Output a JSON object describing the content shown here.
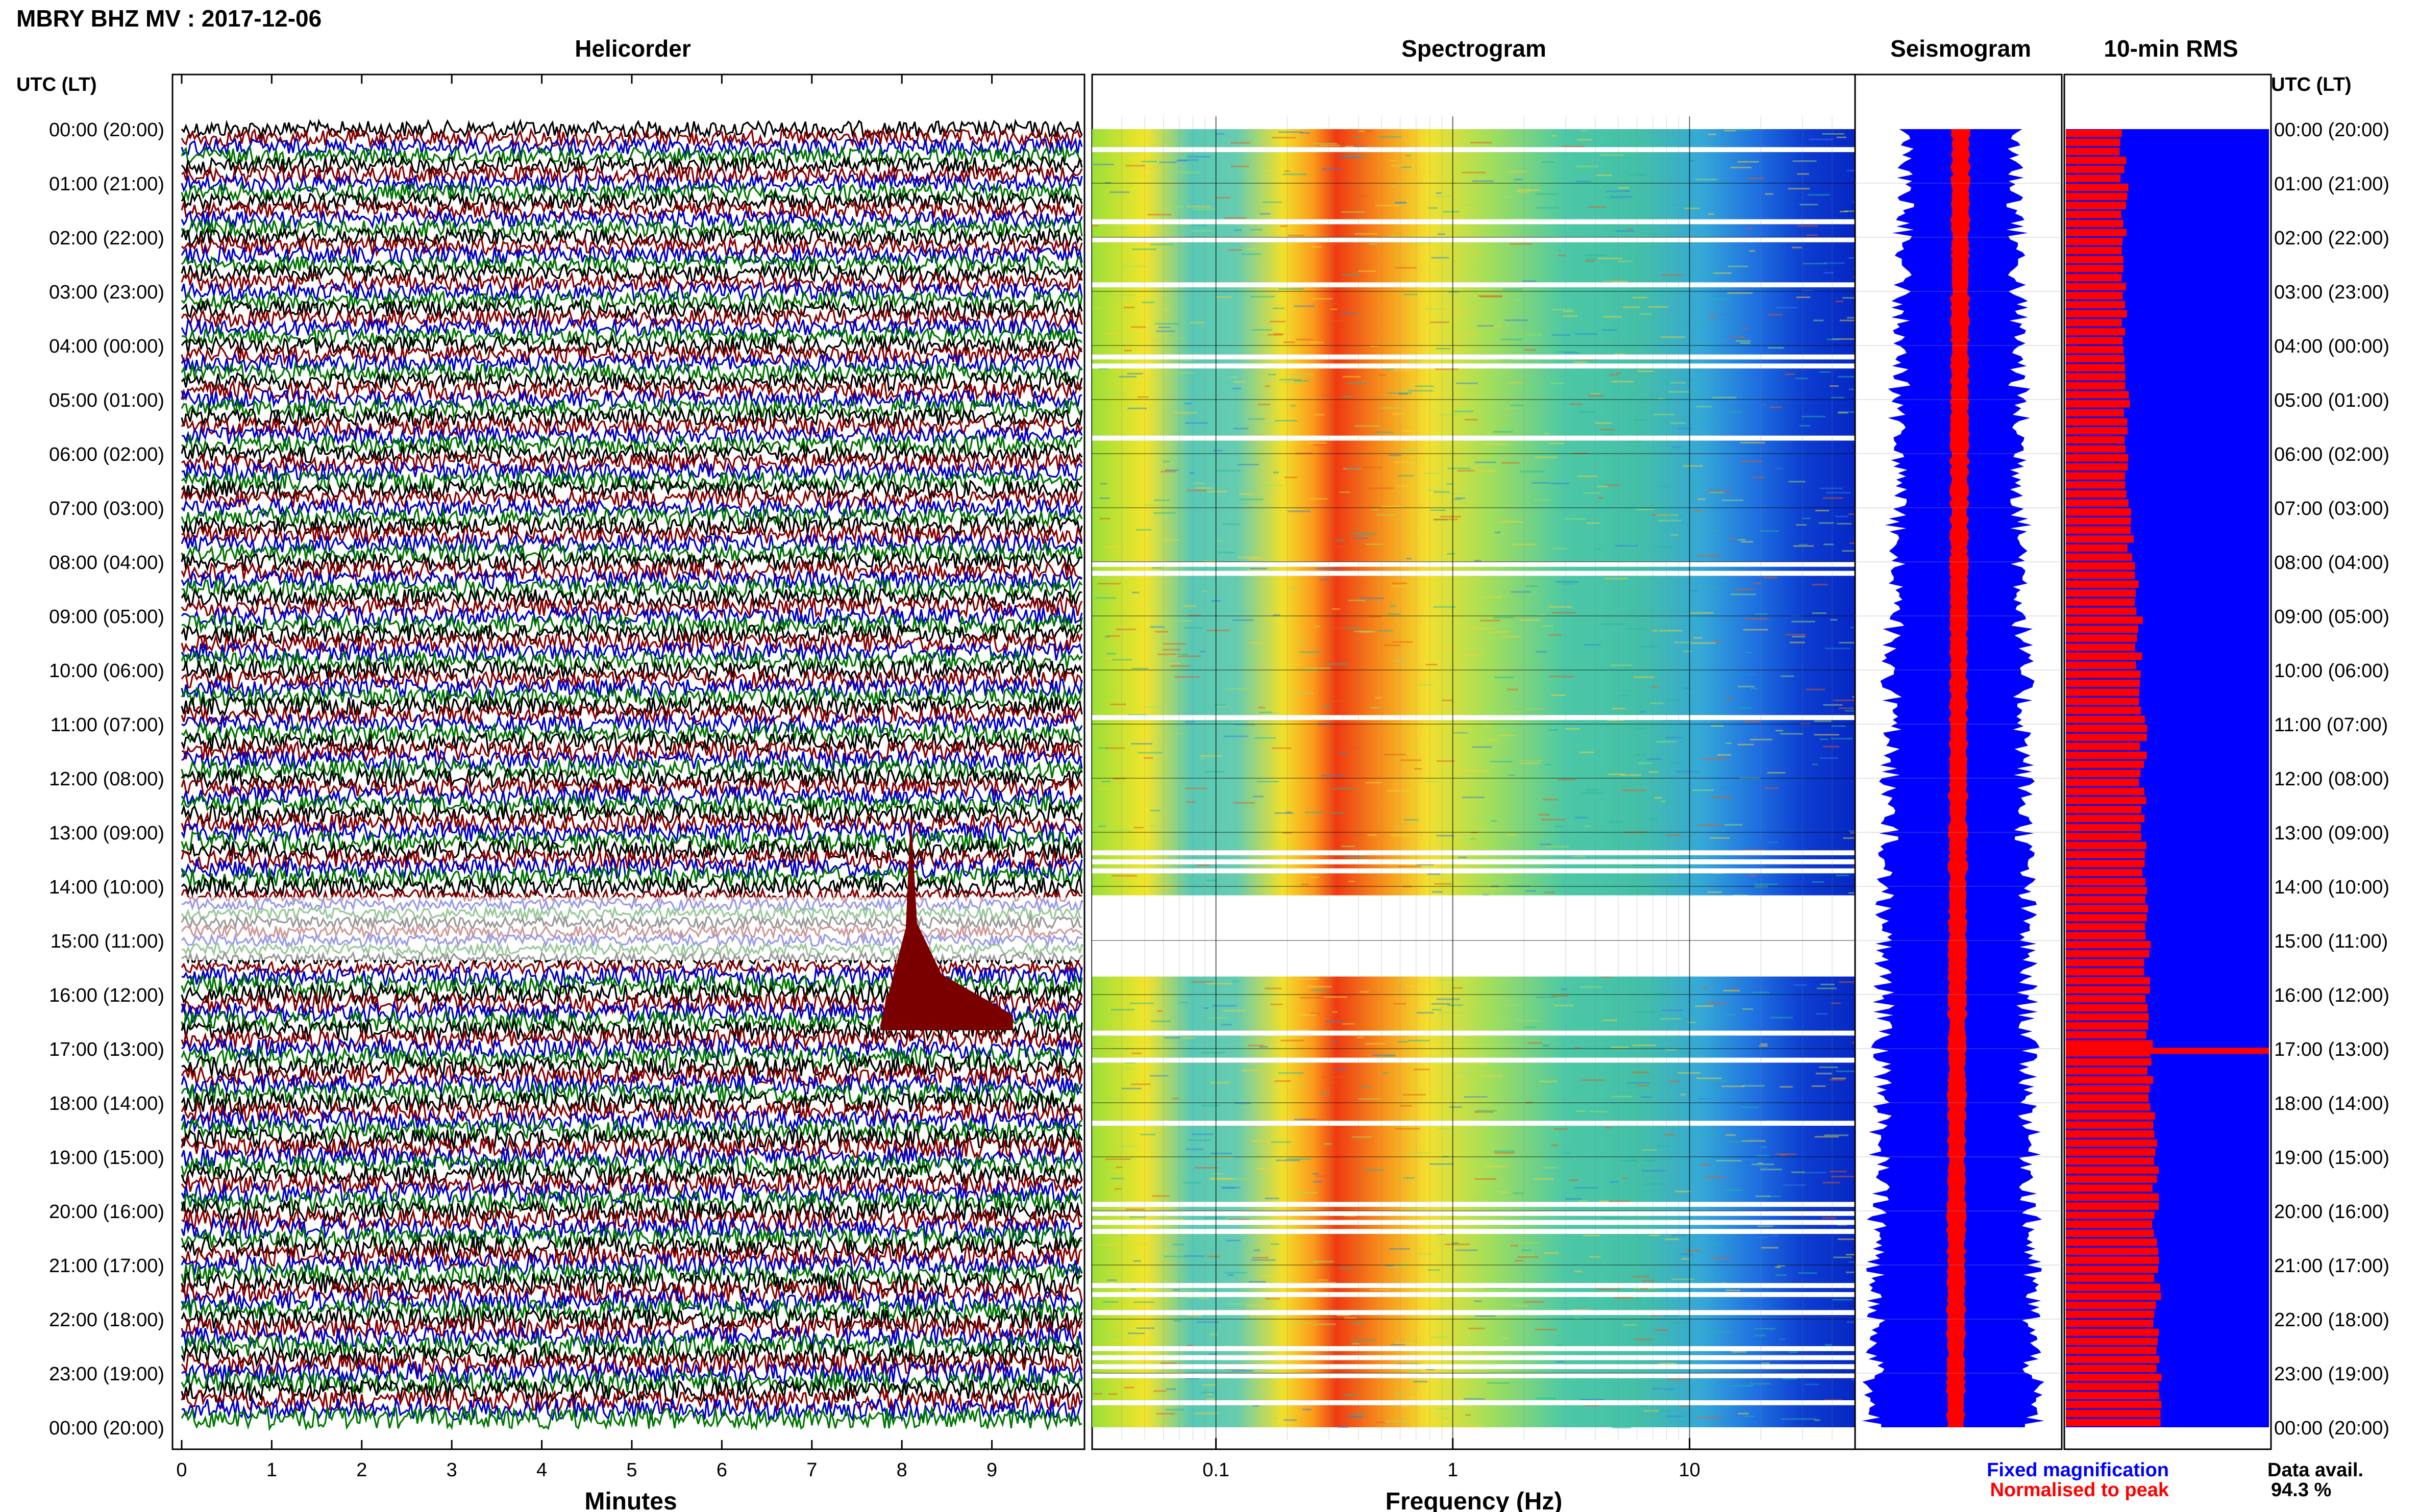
{
  "header": {
    "title": "MBRY BHZ MV : 2017-12-06"
  },
  "time_axis": {
    "label_left": "UTC (LT)",
    "label_right": "UTC (LT)",
    "ticks": [
      "00:00 (20:00)",
      "01:00 (21:00)",
      "02:00 (22:00)",
      "03:00 (23:00)",
      "04:00 (00:00)",
      "05:00 (01:00)",
      "06:00 (02:00)",
      "07:00 (03:00)",
      "08:00 (04:00)",
      "09:00 (05:00)",
      "10:00 (06:00)",
      "11:00 (07:00)",
      "12:00 (08:00)",
      "13:00 (09:00)",
      "14:00 (10:00)",
      "15:00 (11:00)",
      "16:00 (12:00)",
      "17:00 (13:00)",
      "18:00 (14:00)",
      "19:00 (15:00)",
      "20:00 (16:00)",
      "21:00 (17:00)",
      "22:00 (18:00)",
      "23:00 (19:00)",
      "00:00 (20:00)"
    ]
  },
  "legend": {
    "fixed": "Fixed magnification",
    "normalised": "Normalised to peak",
    "data_avail_label": "Data avail.",
    "data_avail_value": "94.3 %"
  },
  "colors": {
    "trace_colors": [
      "#000000",
      "#8b0000",
      "#0000cc",
      "#007700"
    ],
    "fixed": "#0000ff",
    "normalised": "#ff0000"
  },
  "chart_data": [
    {
      "type": "line",
      "title": "Helicorder",
      "xlabel": "Minutes",
      "x_ticks": [
        "0",
        "1",
        "2",
        "3",
        "4",
        "5",
        "6",
        "7",
        "8",
        "9"
      ],
      "xlim": [
        0,
        10
      ],
      "rows": 144,
      "row_minutes": 10,
      "series_colors_cycle": [
        "black",
        "dark red",
        "blue",
        "green"
      ],
      "gaps_utc": [
        "14:10-15:40"
      ],
      "events": [
        {
          "time_utc": "15:58",
          "minute": 8.1,
          "description": "large signal, dark red"
        }
      ]
    },
    {
      "type": "heatmap",
      "title": "Spectrogram",
      "xlabel": "Frequency (Hz)",
      "x_scale": "log",
      "x_ticks": [
        "0.1",
        "1",
        "10"
      ],
      "xlim": [
        0.03,
        50
      ],
      "peak_band_hz": [
        0.2,
        0.5
      ],
      "colormap": "jet"
    },
    {
      "type": "line",
      "title": "Seismogram",
      "series": [
        {
          "name": "Fixed magnification"
        },
        {
          "name": "Normalised to peak"
        }
      ]
    },
    {
      "type": "bar",
      "title": "10-min RMS",
      "orientation": "horizontal",
      "rows": 144,
      "relative_levels_by_hour": [
        0.28,
        0.29,
        0.29,
        0.29,
        0.3,
        0.3,
        0.31,
        0.32,
        0.34,
        0.36,
        0.37,
        0.38,
        0.38,
        0.38,
        0.39,
        0.4,
        0.41,
        0.42,
        0.43,
        0.44,
        0.44,
        0.45,
        0.45,
        0.46
      ],
      "spike_utc": "16:58"
    }
  ]
}
